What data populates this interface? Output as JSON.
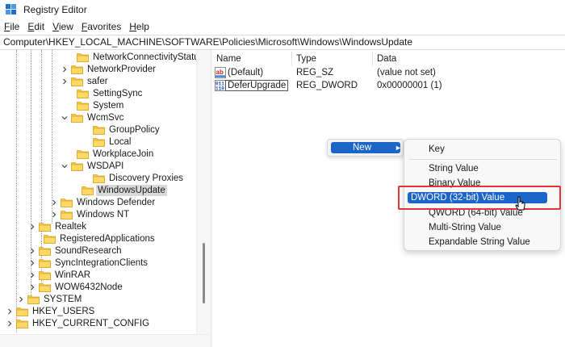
{
  "window": {
    "title": "Registry Editor"
  },
  "menu": [
    {
      "accel": "F",
      "rest": "ile"
    },
    {
      "accel": "E",
      "rest": "dit"
    },
    {
      "accel": "V",
      "rest": "iew"
    },
    {
      "accel": "F",
      "rest": "avorites"
    },
    {
      "accel": "H",
      "rest": "elp"
    }
  ],
  "address": "Computer\\HKEY_LOCAL_MACHINE\\SOFTWARE\\Policies\\Microsoft\\Windows\\WindowsUpdate",
  "tree": {
    "items": [
      {
        "label": "NetworkConnectivityStatusIr",
        "expander": "none"
      },
      {
        "label": "NetworkProvider",
        "expander": "collapsed"
      },
      {
        "label": "safer",
        "expander": "collapsed"
      },
      {
        "label": "SettingSync",
        "expander": "none"
      },
      {
        "label": "System",
        "expander": "none"
      },
      {
        "label": "WcmSvc",
        "expander": "expanded"
      },
      {
        "label": "GroupPolicy",
        "expander": "none"
      },
      {
        "label": "Local",
        "expander": "none"
      },
      {
        "label": "WorkplaceJoin",
        "expander": "none"
      },
      {
        "label": "WSDAPI",
        "expander": "expanded"
      },
      {
        "label": "Discovery Proxies",
        "expander": "none"
      },
      {
        "label": "WindowsUpdate",
        "expander": "none",
        "selected": true
      },
      {
        "label": "Windows Defender",
        "expander": "collapsed"
      },
      {
        "label": "Windows NT",
        "expander": "collapsed"
      },
      {
        "label": "Realtek",
        "expander": "collapsed"
      },
      {
        "label": "RegisteredApplications",
        "expander": "none"
      },
      {
        "label": "SoundResearch",
        "expander": "collapsed"
      },
      {
        "label": "SyncIntegrationClients",
        "expander": "collapsed"
      },
      {
        "label": "WinRAR",
        "expander": "collapsed"
      },
      {
        "label": "WOW6432Node",
        "expander": "collapsed"
      },
      {
        "label": "SYSTEM",
        "expander": "collapsed"
      },
      {
        "label": "HKEY_USERS",
        "expander": "collapsed"
      },
      {
        "label": "HKEY_CURRENT_CONFIG",
        "expander": "collapsed"
      }
    ]
  },
  "values": {
    "columns": {
      "name": "Name",
      "type": "Type",
      "data": "Data"
    },
    "rows": [
      {
        "name": "(Default)",
        "type": "REG_SZ",
        "data": "(value not set)",
        "icon": "string-value-icon"
      },
      {
        "name": "DeferUpgrade",
        "type": "REG_DWORD",
        "data": "0x00000001 (1)",
        "icon": "binary-value-icon"
      }
    ]
  },
  "context_menu": {
    "new_label": "New",
    "submenu": [
      "Key",
      "String Value",
      "Binary Value",
      "DWORD (32-bit) Value",
      "QWORD (64-bit) Value",
      "Multi-String Value",
      "Expandable String Value"
    ],
    "highlighted": "DWORD (32-bit) Value"
  },
  "colors": {
    "accent": "#1a65c7",
    "folder": "#f5c84c",
    "annotation": "#e0353b"
  }
}
